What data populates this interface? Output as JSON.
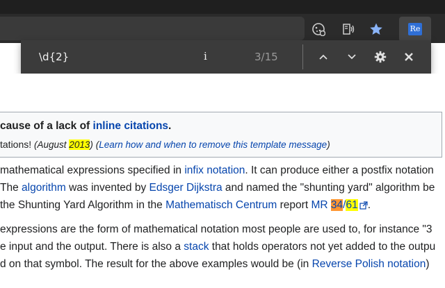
{
  "toolbar": {
    "icons": [
      "cookie-icon",
      "read-aloud-icon",
      "favorite-star-icon"
    ],
    "extension_label": "Re"
  },
  "findbar": {
    "query": "\\d{2}",
    "caret": "i",
    "count": "3/15"
  },
  "ambox": {
    "line1_prefix": "cause of a lack of ",
    "line1_link": "inline citations",
    "line1_suffix": ".",
    "line2_prefix": "tations! ",
    "date_open": "(August ",
    "date_year": "2013",
    "date_close": ")",
    "learn_open": "(",
    "learn_link": "Learn how and when to remove this template message",
    "learn_close": ")"
  },
  "article": {
    "p1": {
      "l1_a": "mathematical expressions specified in ",
      "l1_link": "infix notation",
      "l1_b": ". It can produce either a postfix notation",
      "l2_a": "The ",
      "l2_link1": "algorithm",
      "l2_b": " was invented by ",
      "l2_link2": "Edsger Dijkstra",
      "l2_c": " and named the \"shunting yard\" algorithm be",
      "l3_a": "the Shunting Yard Algorithm in the ",
      "l3_link1": "Mathematisch Centrum",
      "l3_b": " report ",
      "l3_link2": "MR ",
      "l3_match_current": "34",
      "l3_slash": "/",
      "l3_match": "61",
      "l3_end": "."
    },
    "p2": {
      "l1": " expressions are the form of mathematical notation most people are used to, for instance \"3",
      "l2_a": "e input and the output. There is also a ",
      "l2_link": "stack",
      "l2_b": " that holds operators not yet added to the outpu",
      "l3_a": "d on that symbol. The result for the above examples would be (in ",
      "l3_link": "Reverse Polish notation",
      "l3_b": ")"
    }
  },
  "colors": {
    "link": "#0645ad",
    "match_highlight": "#ffff00",
    "current_match_highlight": "#ff9632",
    "chrome_dark": "#2b2b2b",
    "findbar_bg": "#3b3b3b",
    "extension_accent": "#2f6fd6"
  }
}
